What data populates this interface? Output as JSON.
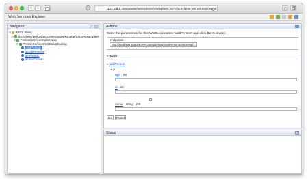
{
  "toolbar": {
    "back": "<",
    "forward": ">",
    "address_bold": "127.0.0.1",
    "address_rest": ":49656/wse/wsexplorer/wsexplorer.jsp?org.eclipse.wst.ws.explorer=8"
  },
  "app": {
    "title": "Web Services Explorer"
  },
  "navigator": {
    "title": "Navigator",
    "tree": [
      {
        "label": "WSDL Main",
        "depth": 0,
        "icon": "folder"
      },
      {
        "label": "file:/Users/perkay/Documents/workspace/SOAPExample/s",
        "depth": 1,
        "icon": "green"
      },
      {
        "label": "PersonServiceImplService",
        "depth": 2,
        "icon": "green"
      },
      {
        "label": "PersonServiceImplSoapBinding",
        "depth": 3,
        "icon": "green"
      },
      {
        "label": "addPerson",
        "depth": 4,
        "icon": "blue",
        "selected": true
      },
      {
        "label": "getAllPersons",
        "depth": 4,
        "icon": "blue"
      },
      {
        "label": "getPerson",
        "depth": 4,
        "icon": "blue"
      },
      {
        "label": "deletePerson",
        "depth": 4,
        "icon": "blue"
      }
    ]
  },
  "actions": {
    "title": "Actions",
    "intro_pre": "Enter the parameters for this WSDL operation \"addPerson\" and click ",
    "intro_go": "Go",
    "intro_post": " to invoke.",
    "endpoints_legend": "Endpoints",
    "endpoint_value": "http://localhost:8080/SOAPExample/services/PersonServiceImpl",
    "body_label": "Body",
    "operation_link": "addPerson",
    "param_p": "p",
    "fields": [
      {
        "name": "age",
        "type": "int"
      },
      {
        "name": "id",
        "type": "int"
      },
      {
        "name": "name",
        "type": "string",
        "nillable": "NIL"
      }
    ],
    "go_button": "Go",
    "reset_button": "Reset"
  },
  "status": {
    "title": "Status"
  },
  "colors": {
    "accent": "#3875d7",
    "link": "#1f4fbf"
  }
}
